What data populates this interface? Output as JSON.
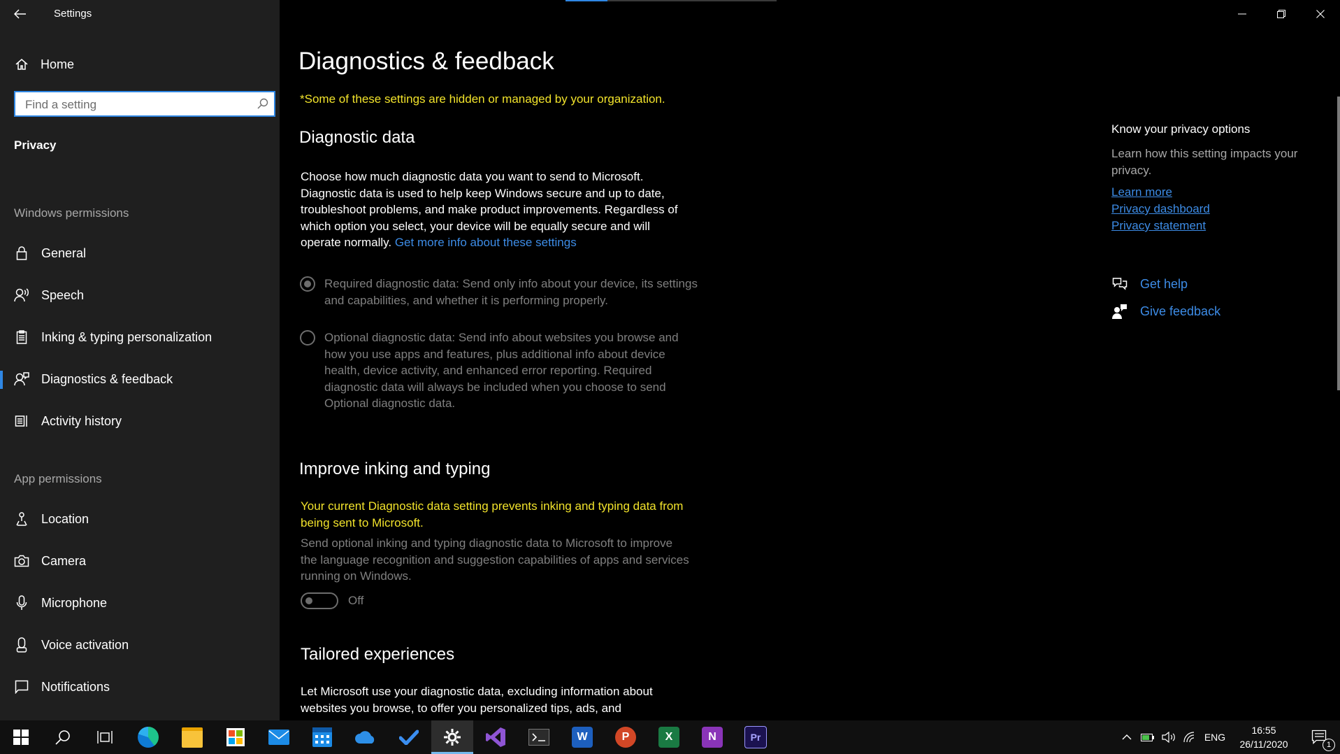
{
  "window": {
    "title": "Settings"
  },
  "sidebar": {
    "home_label": "Home",
    "search_placeholder": "Find a setting",
    "current_section": "Privacy",
    "windows_permissions_heading": "Windows permissions",
    "windows_items": [
      {
        "label": "General",
        "icon": "lock-icon"
      },
      {
        "label": "Speech",
        "icon": "speech-icon"
      },
      {
        "label": "Inking & typing personalization",
        "icon": "clipboard-icon"
      },
      {
        "label": "Diagnostics & feedback",
        "icon": "person-feedback-icon"
      },
      {
        "label": "Activity history",
        "icon": "timeline-icon"
      }
    ],
    "app_permissions_heading": "App permissions",
    "app_items": [
      {
        "label": "Location",
        "icon": "location-icon"
      },
      {
        "label": "Camera",
        "icon": "camera-icon"
      },
      {
        "label": "Microphone",
        "icon": "microphone-icon"
      },
      {
        "label": "Voice activation",
        "icon": "voice-icon"
      },
      {
        "label": "Notifications",
        "icon": "notification-icon"
      }
    ]
  },
  "main": {
    "page_title": "Diagnostics & feedback",
    "org_note": "*Some of these settings are hidden or managed by your organization.",
    "diagnostic_data": {
      "heading": "Diagnostic data",
      "description": "Choose how much diagnostic data you want to send to Microsoft. Diagnostic data is used to help keep Windows secure and up to date, troubleshoot problems, and make product improvements. Regardless of which option you select, your device will be equally secure and will operate normally.",
      "link": "Get more info about these settings",
      "options": [
        {
          "label": "Required diagnostic data: Send only info about your device, its settings and capabilities, and whether it is performing properly.",
          "selected": true
        },
        {
          "label": "Optional diagnostic data: Send info about websites you browse and how you use apps and features, plus additional info about device health, device activity, and enhanced error reporting. Required diagnostic data will always be included when you choose to send Optional diagnostic data.",
          "selected": false
        }
      ]
    },
    "inking": {
      "heading": "Improve inking and typing",
      "warning": "Your current Diagnostic data setting prevents inking and typing data from being sent to Microsoft.",
      "description": "Send optional inking and typing diagnostic data to Microsoft to improve the language recognition and suggestion capabilities of apps and services running on Windows.",
      "toggle_state": "Off"
    },
    "tailored": {
      "heading": "Tailored experiences",
      "description": "Let Microsoft use your diagnostic data, excluding information about websites you browse, to offer you personalized tips, ads, and"
    }
  },
  "rail": {
    "title": "Know your privacy options",
    "description": "Learn how this setting impacts your privacy.",
    "links": [
      "Learn more",
      "Privacy dashboard",
      "Privacy statement"
    ],
    "get_help": "Get help",
    "give_feedback": "Give feedback"
  },
  "taskbar": {
    "apps": [
      "start",
      "search",
      "task-view",
      "edge-dev",
      "file-explorer",
      "store",
      "mail",
      "calendar",
      "onedrive",
      "todo",
      "settings",
      "visual-studio",
      "terminal",
      "word",
      "powerpoint",
      "excel",
      "onenote",
      "premiere"
    ],
    "word_letter": "W",
    "powerpoint_letter": "P",
    "excel_letter": "X",
    "onenote_letter": "N",
    "premiere_letter": "Pr",
    "language": "ENG",
    "time": "16:55",
    "date": "26/11/2020",
    "notification_count": "1"
  },
  "colors": {
    "accent": "#2f87e4",
    "warning": "#f2e32b",
    "link": "#3d8ce6",
    "sidebar_bg": "#1f1f1f",
    "main_bg": "#000000"
  }
}
